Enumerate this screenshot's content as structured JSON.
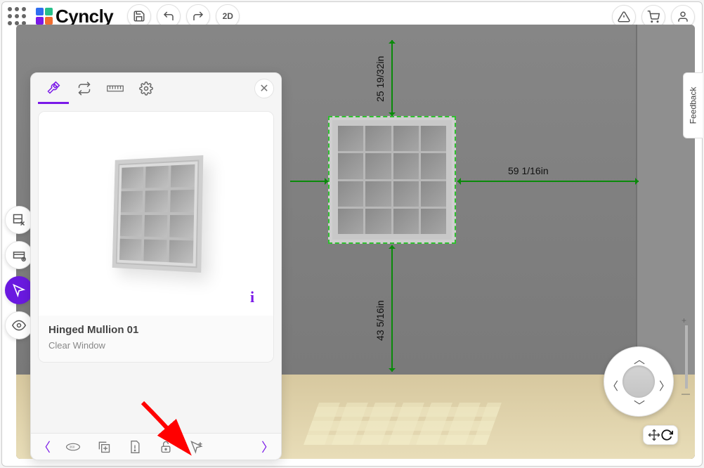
{
  "app": {
    "brand": "Cyncly",
    "view_toggle": "2D"
  },
  "topright": {
    "warning": "alert-icon",
    "cart": "cart-icon",
    "user": "user-icon"
  },
  "feedback": {
    "label": "Feedback"
  },
  "panel": {
    "item_title": "Hinged Mullion 01",
    "item_subtitle": "Clear Window",
    "info_glyph": "i"
  },
  "dimensions": {
    "top": "25 19/32in",
    "bottom": "43 5/16in",
    "right": "59 1/16in"
  }
}
